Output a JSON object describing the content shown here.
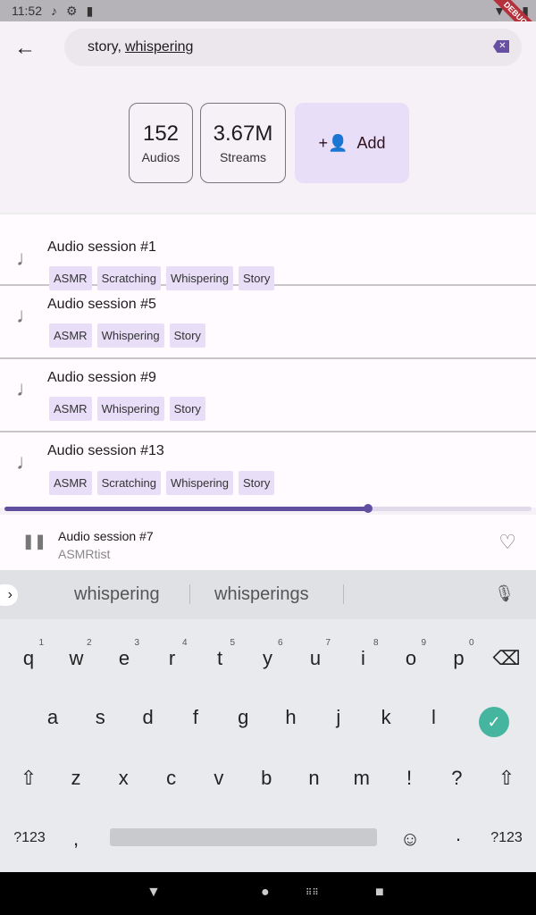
{
  "status_bar": {
    "time": "11:52",
    "debug_banner": "DEBUG"
  },
  "search": {
    "value_prefix": "story,",
    "value_word": "whispering"
  },
  "stats": {
    "audios_count": "152",
    "audios_label": "Audios",
    "streams_count": "3.67M",
    "streams_label": "Streams",
    "add_label": "Add"
  },
  "list": [
    {
      "title": "Audio session #1",
      "tags": [
        "ASMR",
        "Scratching",
        "Whispering",
        "Story"
      ]
    },
    {
      "title": "Audio session #5",
      "tags": [
        "ASMR",
        "Whispering",
        "Story"
      ]
    },
    {
      "title": "Audio session #9",
      "tags": [
        "ASMR",
        "Whispering",
        "Story"
      ]
    },
    {
      "title": "Audio session #13",
      "tags": [
        "ASMR",
        "Scratching",
        "Whispering",
        "Story"
      ]
    }
  ],
  "player": {
    "title": "Audio session #7",
    "artist": "ASMRtist",
    "progress": 0.69,
    "state": "playing"
  },
  "keyboard": {
    "suggestions": [
      "whispering",
      "whisperings"
    ],
    "row1": [
      "q",
      "w",
      "e",
      "r",
      "t",
      "y",
      "u",
      "i",
      "o",
      "p"
    ],
    "row1_nums": [
      "1",
      "2",
      "3",
      "4",
      "5",
      "6",
      "7",
      "8",
      "9",
      "0"
    ],
    "row2": [
      "a",
      "s",
      "d",
      "f",
      "g",
      "h",
      "j",
      "k",
      "l"
    ],
    "row3": [
      "z",
      "x",
      "c",
      "v",
      "b",
      "n",
      "m",
      "!",
      "?"
    ],
    "symbols_label": "?123",
    "comma": ",",
    "period": "·"
  },
  "colors": {
    "accent": "#6750a4",
    "tag_bg": "#e8def8",
    "enter": "#46b59f"
  }
}
